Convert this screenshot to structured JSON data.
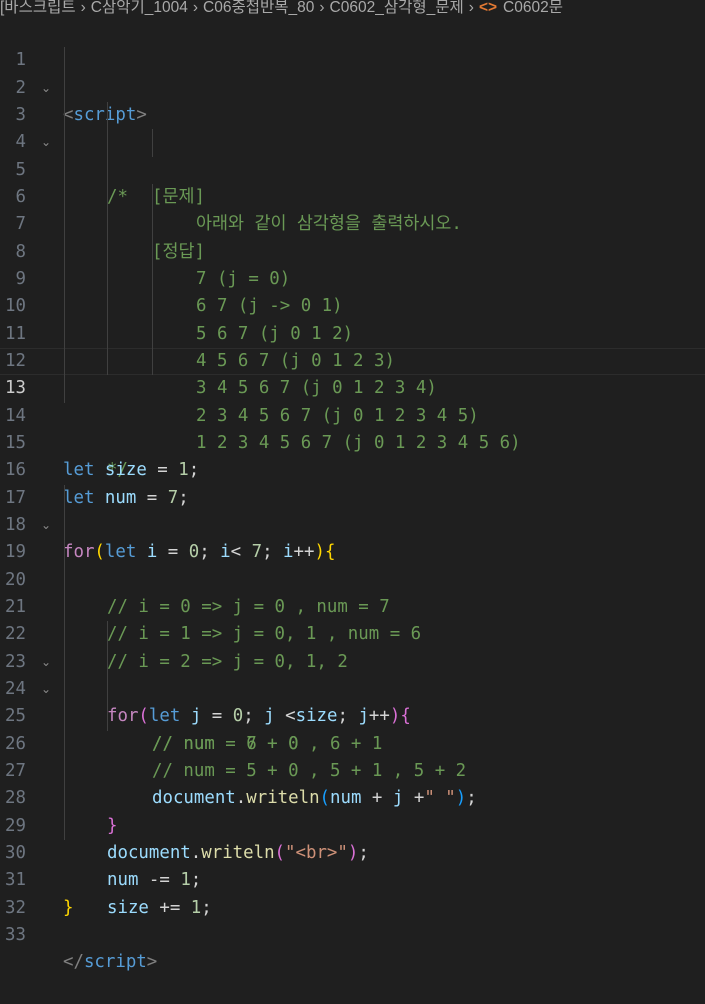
{
  "breadcrumb": {
    "items": [
      "[바스크립트",
      "C삼악기_1004",
      "C06중첩반복_80",
      "C0602_삼각형_문제"
    ],
    "current_file": "C0602문"
  },
  "editor": {
    "current_line": 13,
    "line_numbers": [
      "1",
      "2",
      "3",
      "4",
      "5",
      "6",
      "7",
      "8",
      "9",
      "10",
      "11",
      "12",
      "13",
      "14",
      "15",
      "16",
      "17",
      "18",
      "19",
      "20",
      "21",
      "22",
      "23",
      "24",
      "25",
      "26",
      "27",
      "28",
      "29",
      "30",
      "31",
      "32",
      "33"
    ],
    "lines": {
      "l1": {
        "open": "<",
        "tag": "script",
        "close": ">"
      },
      "l3": "/*",
      "l4": "[문제]",
      "l5": "아래와 같이 삼각형을 출력하시오.",
      "l6": "[정답]",
      "l7": "7 (j = 0)",
      "l8": "6 7 (j -> 0 1)",
      "l9": "5 6 7 (j 0 1 2)",
      "l10": "4 5 6 7 (j 0 1 2 3)",
      "l11": "3 4 5 6 7 (j 0 1 2 3 4)",
      "l12": "2 3 4 5 6 7 (j 0 1 2 3 4 5)",
      "l13": "1 2 3 4 5 6 7 (j 0 1 2 3 4 5 6)",
      "l14": "*/",
      "l15": {
        "kw": "let",
        "var": "size",
        "op": " = ",
        "num": "1",
        "end": ";"
      },
      "l16": {
        "kw": "let",
        "var": "num",
        "op": " = ",
        "num": "7",
        "end": ";"
      },
      "l17": {
        "for": "for",
        "p_open": "(",
        "kw": "let",
        "var_i": "i",
        "op1": " = ",
        "n0": "0",
        "sep1": "; ",
        "var_i2": "i",
        "op2": "< ",
        "n7": "7",
        "sep2": "; ",
        "var_i3": "i",
        "inc": "++",
        "p_close": ")",
        "brace": "{"
      },
      "l19": "// i = 0 => j = 0 , num = 7",
      "l20": "// i = 1 => j = 0, 1 , num = 6",
      "l21": "// i = 2 => j = 0, 1, 2",
      "l22": {
        "for": "for",
        "p_open": "(",
        "kw": "let",
        "var_j": "j",
        "op1": " = ",
        "n0": "0",
        "sep1": "; ",
        "var_j2": "j",
        "op2": " <",
        "var_size": "size",
        "sep2": "; ",
        "var_j3": "j",
        "inc": "++",
        "p_close": ")",
        "brace": "{"
      },
      "l23": "// num = 7 + 0",
      "l24": "// num = 6 + 0 , 6 + 1",
      "l25": "// num = 5 + 0 , 5 + 1 , 5 + 2",
      "l26": {
        "obj": "document",
        "dot": ".",
        "fn": "writeln",
        "p_open": "(",
        "var_num": "num",
        "op1": " + ",
        "var_j": "j",
        "op2": " +",
        "str": "\" \"",
        "p_close": ")",
        "end": ";"
      },
      "l27": "}",
      "l28": {
        "obj": "document",
        "dot": ".",
        "fn": "writeln",
        "p_open": "(",
        "str": "\"<br>\"",
        "p_close": ")",
        "end": ";"
      },
      "l29": {
        "var": "num",
        "op": " -= ",
        "num": "1",
        "end": ";"
      },
      "l30": {
        "var": "size",
        "op": " += ",
        "num": "1",
        "end": ";"
      },
      "l31": "}",
      "l33": {
        "open": "</",
        "tag": "script",
        "close": ">"
      }
    }
  },
  "colors": {
    "background": "#1f1f1f",
    "keyword": "#569cd6",
    "control_keyword": "#c586c0",
    "variable": "#9cdcfe",
    "function": "#dcdcaa",
    "number": "#b5cea8",
    "string": "#ce9178",
    "comment": "#6a9955",
    "bracket_level1": "#ffd700",
    "bracket_level2": "#da70d6",
    "bracket_level3": "#179fff"
  },
  "icons": {
    "fold": "chevron-down-icon",
    "html_file": "html-file-icon"
  }
}
